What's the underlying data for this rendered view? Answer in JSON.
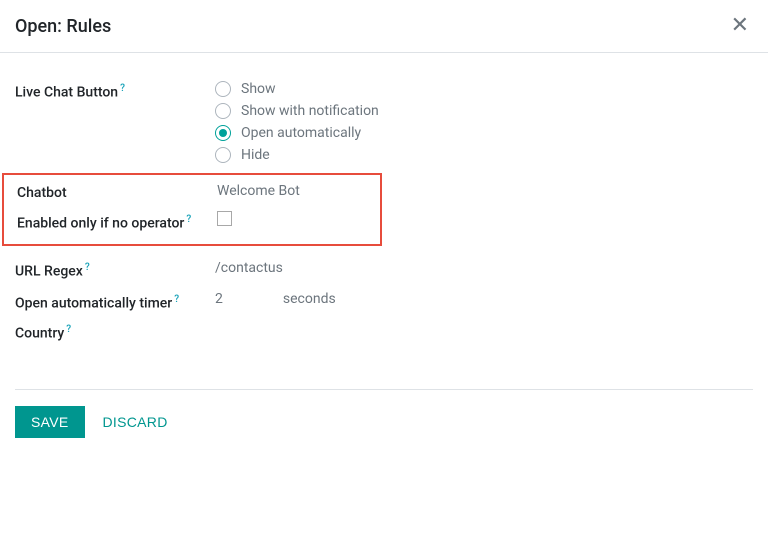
{
  "header": {
    "title": "Open: Rules"
  },
  "fields": {
    "liveChatButton": {
      "label": "Live Chat Button",
      "options": {
        "show": "Show",
        "showNotif": "Show with notification",
        "openAuto": "Open automatically",
        "hide": "Hide"
      },
      "selected": "openAuto"
    },
    "chatbot": {
      "label": "Chatbot",
      "value": "Welcome Bot"
    },
    "enabledNoOp": {
      "label": "Enabled only if no operator",
      "checked": false
    },
    "urlRegex": {
      "label": "URL Regex",
      "value": "/contactus"
    },
    "openAutoTimer": {
      "label": "Open automatically timer",
      "value": "2",
      "unit": "seconds"
    },
    "country": {
      "label": "Country"
    }
  },
  "helpMark": "?",
  "footer": {
    "save": "SAVE",
    "discard": "DISCARD"
  }
}
